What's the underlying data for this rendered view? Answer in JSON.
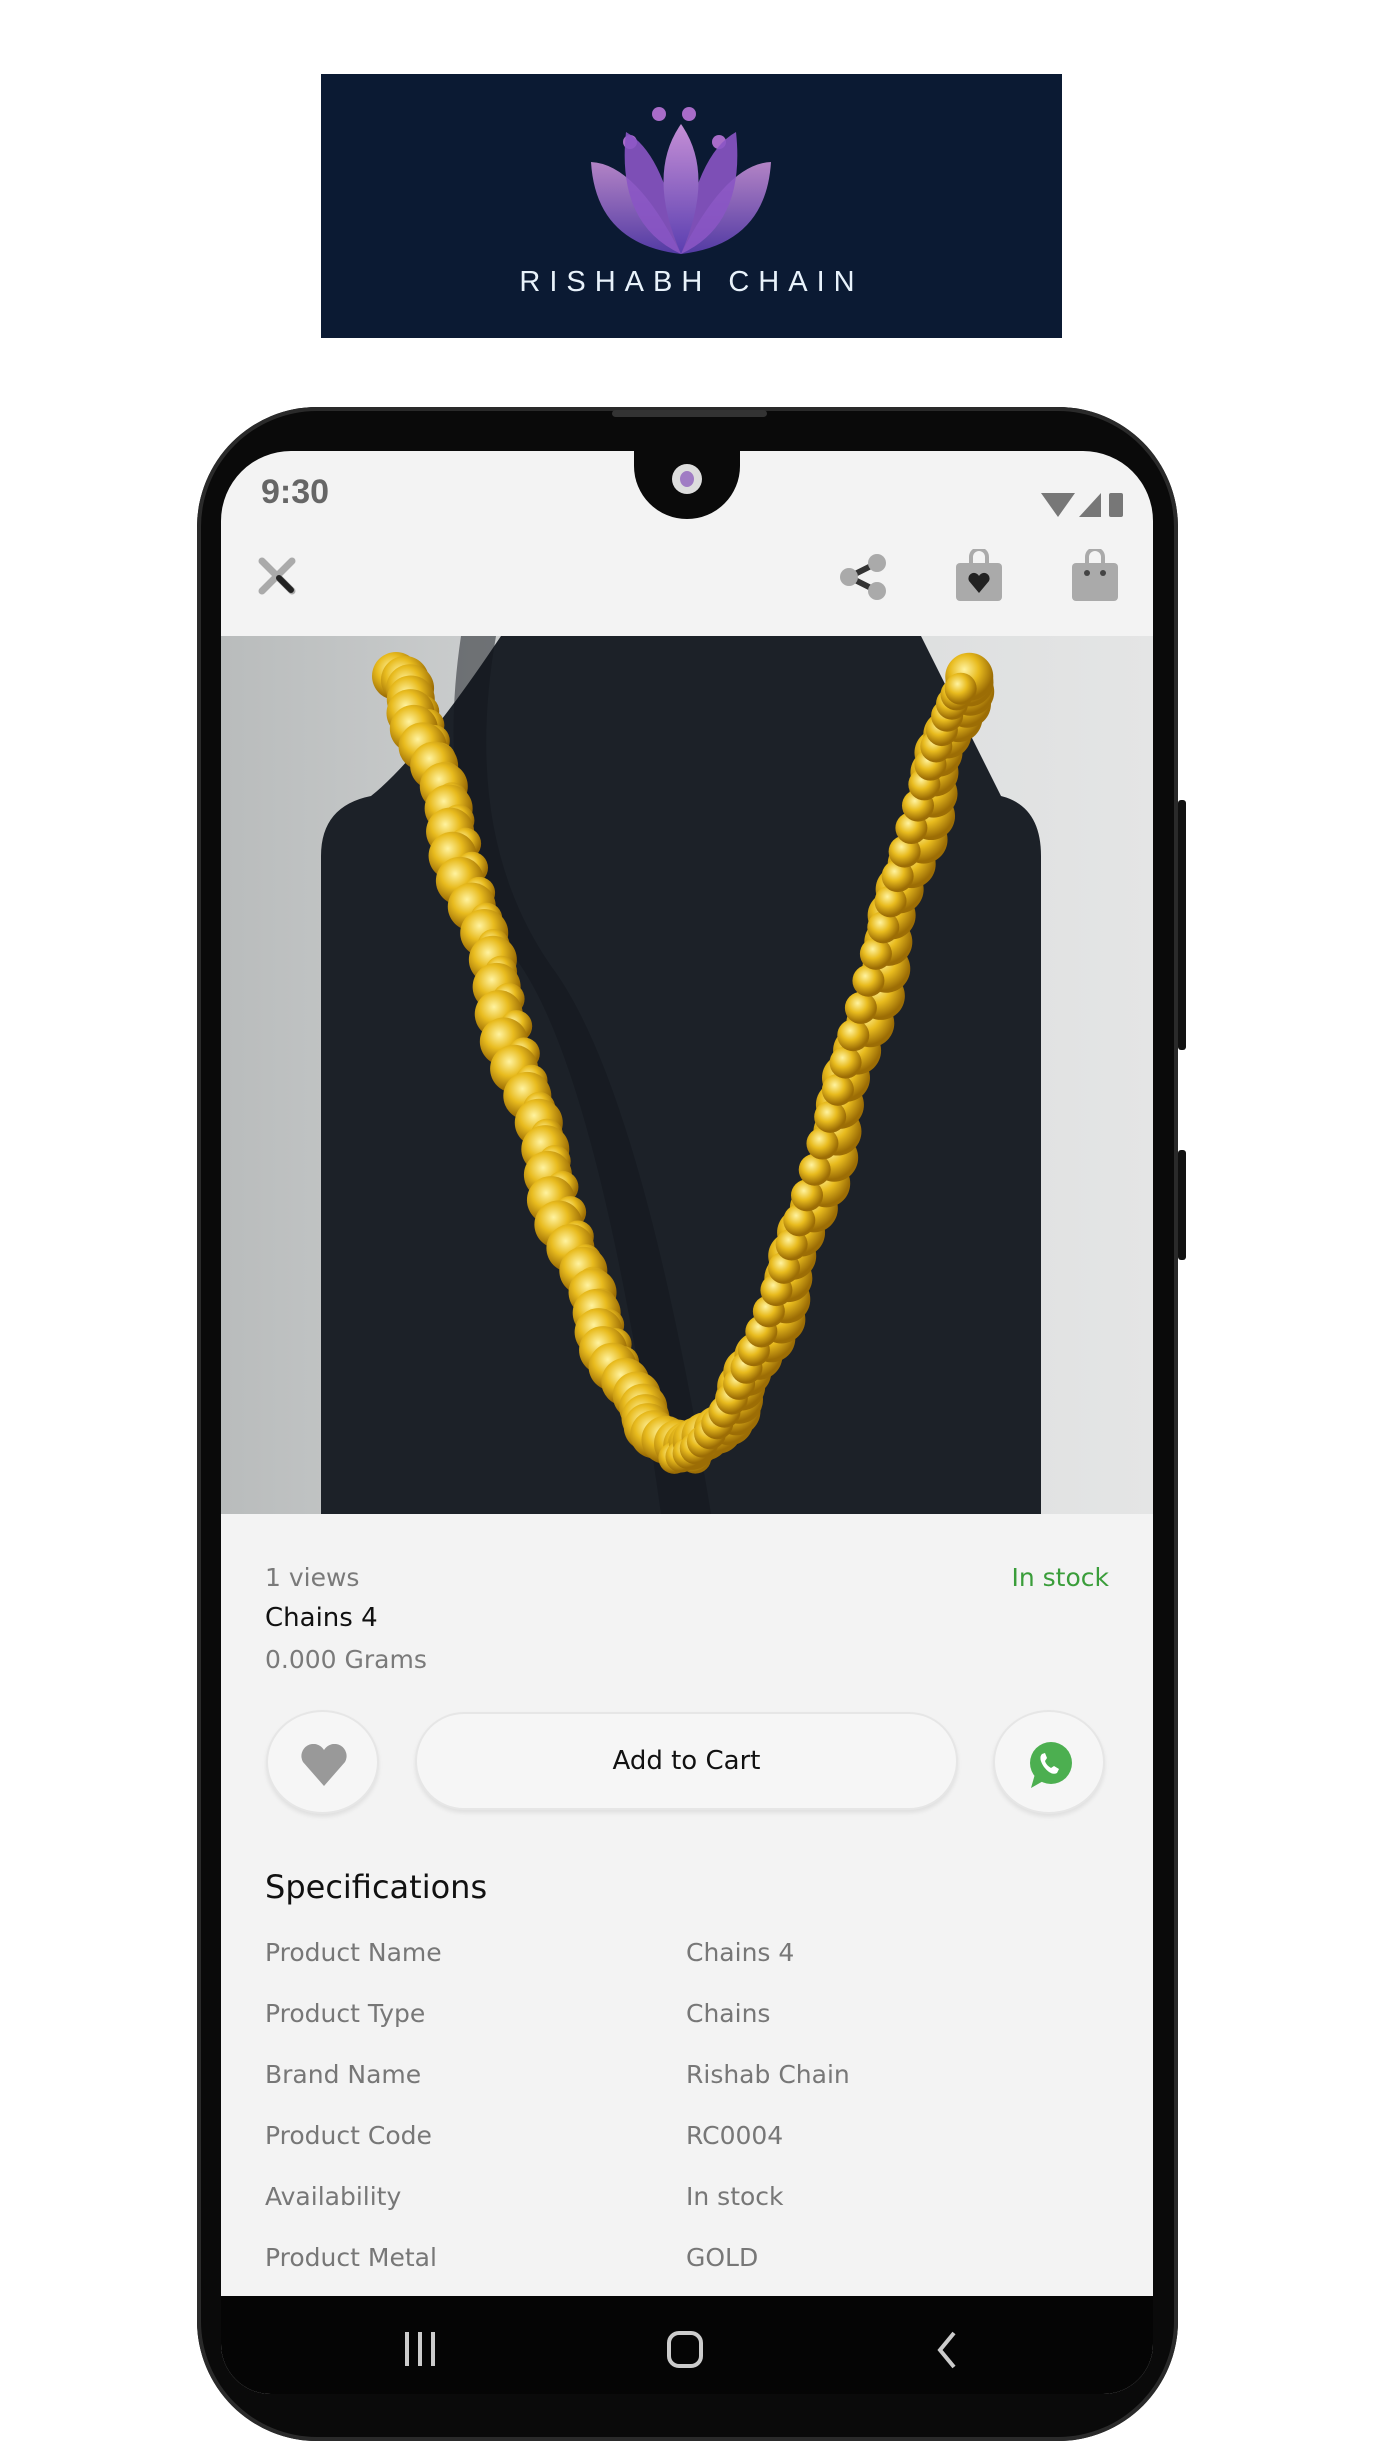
{
  "logo": {
    "brand": "RISHABH CHAIN",
    "bg": "#0b1a33"
  },
  "status_bar": {
    "time": "9:30",
    "icons": [
      "wifi-icon",
      "signal-icon",
      "battery-icon"
    ]
  },
  "toolbar": {
    "icons": [
      "close-icon",
      "share-icon",
      "wishlist-bag-icon",
      "cart-bag-icon"
    ]
  },
  "product": {
    "views": "1 views",
    "stock": "In stock",
    "name": "Chains 4",
    "weight": "0.000 Grams",
    "stock_color": "#3a9d3a"
  },
  "actions": {
    "add_to_cart": "Add to Cart",
    "wishlist_icon": "heart-icon",
    "whatsapp_icon": "whatsapp-icon",
    "whatsapp_color": "#4caf50"
  },
  "specs": {
    "title": "Specifications",
    "rows": [
      {
        "label": "Product Name",
        "value": "Chains 4"
      },
      {
        "label": "Product Type",
        "value": "Chains"
      },
      {
        "label": "Brand Name",
        "value": "Rishab Chain"
      },
      {
        "label": "Product Code",
        "value": "RC0004"
      },
      {
        "label": "Availability",
        "value": "In stock"
      },
      {
        "label": "Product Metal",
        "value": "GOLD"
      }
    ]
  },
  "nav_bar": {
    "icons": [
      "recent-apps-icon",
      "home-icon",
      "back-icon"
    ]
  }
}
